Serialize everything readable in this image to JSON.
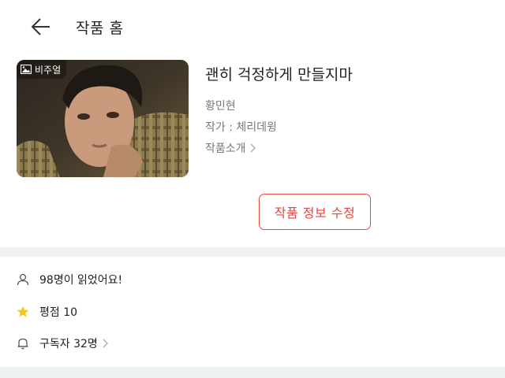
{
  "header": {
    "title": "작품 홈"
  },
  "cover": {
    "badge_label": "비주얼",
    "badge_icon": "image-icon"
  },
  "work": {
    "title": "괜히 걱정하게 만들지마",
    "author": "황민현",
    "writer": "작가 : 체리데윙",
    "intro_label": "작품소개"
  },
  "actions": {
    "edit_label": "작품 정보 수정"
  },
  "stats": {
    "reads": "98명이 읽었어요!",
    "rating": "평점 10",
    "subscribers": "구독자 32명"
  },
  "colors": {
    "accent": "#e8453c",
    "star": "#f5c518",
    "divider": "#eef1f1"
  }
}
